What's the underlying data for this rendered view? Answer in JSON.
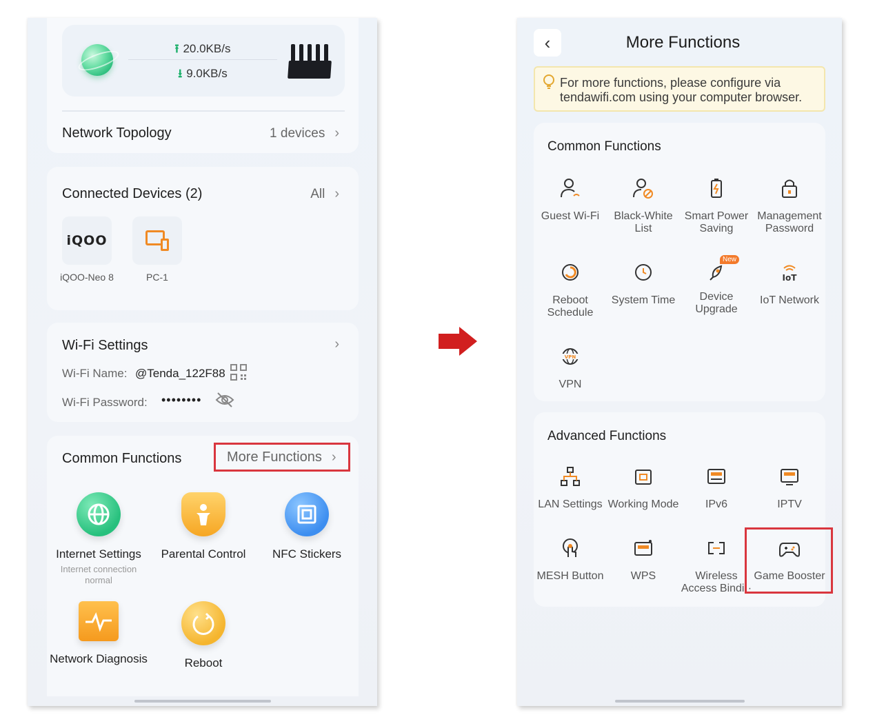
{
  "left": {
    "upload_speed": "20.0KB/s",
    "download_speed": "9.0KB/s",
    "network_topology": {
      "label": "Network Topology",
      "value": "1 devices"
    },
    "connected_devices": {
      "title": "Connected Devices (2)",
      "all_label": "All",
      "devices": [
        {
          "name": "iQOO-Neo 8",
          "logo": "iQOO"
        },
        {
          "name": "PC-1"
        }
      ]
    },
    "wifi": {
      "title": "Wi-Fi Settings",
      "name_label": "Wi-Fi Name:",
      "name_value": "@Tenda_122F88",
      "password_label": "Wi-Fi Password:",
      "password_value": "••••••••"
    },
    "common_functions": {
      "title": "Common Functions",
      "more_label": "More Functions",
      "items": [
        {
          "label": "Internet Settings",
          "sub": "Internet connection normal",
          "icon": "globe-icon"
        },
        {
          "label": "Parental Control",
          "icon": "parental-shield-icon"
        },
        {
          "label": "NFC Stickers",
          "icon": "nfc-icon"
        },
        {
          "label": "Network Diagnosis",
          "icon": "pulse-icon"
        },
        {
          "label": "Reboot",
          "icon": "reboot-icon"
        }
      ]
    }
  },
  "right": {
    "title": "More Functions",
    "notice": "For more functions, please configure via tendawifi.com using your computer browser.",
    "common": {
      "title": "Common Functions",
      "items": [
        {
          "label": "Guest Wi-Fi"
        },
        {
          "label": "Black-White List"
        },
        {
          "label": "Smart Power Saving"
        },
        {
          "label": "Management Password"
        },
        {
          "label": "Reboot Schedule"
        },
        {
          "label": "System Time"
        },
        {
          "label": "Device Upgrade",
          "badge": "New"
        },
        {
          "label": "IoT Network"
        },
        {
          "label": "VPN"
        }
      ]
    },
    "advanced": {
      "title": "Advanced Functions",
      "items": [
        {
          "label": "LAN Settings"
        },
        {
          "label": "Working Mode"
        },
        {
          "label": "IPv6"
        },
        {
          "label": "IPTV"
        },
        {
          "label": "MESH Button"
        },
        {
          "label": "WPS"
        },
        {
          "label": "Wireless Access Bindi··"
        },
        {
          "label": "Game Booster"
        }
      ]
    }
  },
  "colors": {
    "accent_red": "#d9363e",
    "accent_orange": "#f08a24",
    "accent_green": "#1fb06c",
    "accent_blue": "#3d8ef0"
  }
}
